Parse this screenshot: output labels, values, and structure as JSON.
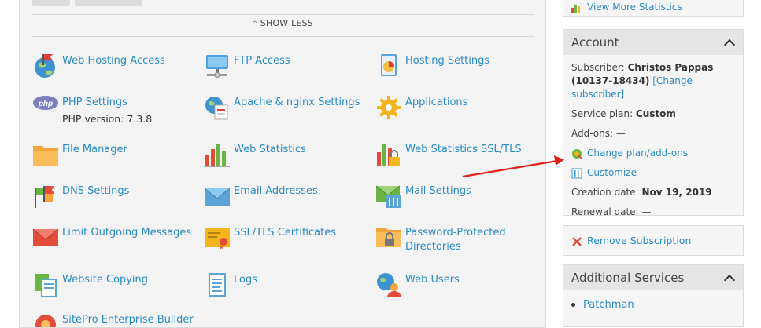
{
  "main": {
    "show_less": "SHOW LESS",
    "tools": [
      {
        "label": "Web Hosting Access",
        "icon": "globe-flag-icon"
      },
      {
        "label": "FTP Access",
        "icon": "ftp-folder-icon"
      },
      {
        "label": "Hosting Settings",
        "icon": "hosting-settings-icon"
      },
      {
        "label": "PHP Settings",
        "sub": "PHP version: 7.3.8",
        "icon": "php-icon"
      },
      {
        "label": "Apache & nginx Settings",
        "icon": "apache-globe-icon"
      },
      {
        "label": "Applications",
        "icon": "gear-icon"
      },
      {
        "label": "File Manager",
        "icon": "folder-icon"
      },
      {
        "label": "Web Statistics",
        "icon": "bar-chart-icon"
      },
      {
        "label": "Web Statistics SSL/TLS",
        "icon": "bar-chart-lock-icon"
      },
      {
        "label": "DNS Settings",
        "icon": "dns-flags-icon"
      },
      {
        "label": "Email Addresses",
        "icon": "envelope-icon"
      },
      {
        "label": "Mail Settings",
        "icon": "mail-settings-icon"
      },
      {
        "label": "Limit Outgoing Messages",
        "icon": "envelope-limit-icon"
      },
      {
        "label": "SSL/TLS Certificates",
        "icon": "certificate-icon"
      },
      {
        "label": "Password-Protected Directories",
        "icon": "folder-lock-icon"
      },
      {
        "label": "Website Copying",
        "icon": "copy-pages-icon"
      },
      {
        "label": "Logs",
        "icon": "logs-icon"
      },
      {
        "label": "Web Users",
        "icon": "web-users-icon"
      },
      {
        "label": "SitePro Enterprise Builder",
        "icon": "sitepro-icon"
      }
    ]
  },
  "sidebar": {
    "view_more_statistics": "View More Statistics",
    "account": {
      "title": "Account",
      "subscriber_label": "Subscriber:",
      "subscriber_name": "Christos Pappas (10137-18434)",
      "change_subscriber": "[Change subscriber]",
      "service_plan_label": "Service plan:",
      "service_plan_value": "Custom",
      "addons_label": "Add-ons:",
      "addons_value": "—",
      "change_plan": "Change plan/add-ons",
      "customize": "Customize",
      "creation_label": "Creation date:",
      "creation_value": "Nov 19, 2019",
      "renewal_label": "Renewal date:",
      "renewal_value": "—"
    },
    "remove_subscription": "Remove Subscription",
    "additional_services": {
      "title": "Additional Services",
      "items": [
        "Patchman"
      ]
    }
  },
  "colors": {
    "link": "#2a8ac2",
    "annotation_arrow": "#e0201b"
  }
}
